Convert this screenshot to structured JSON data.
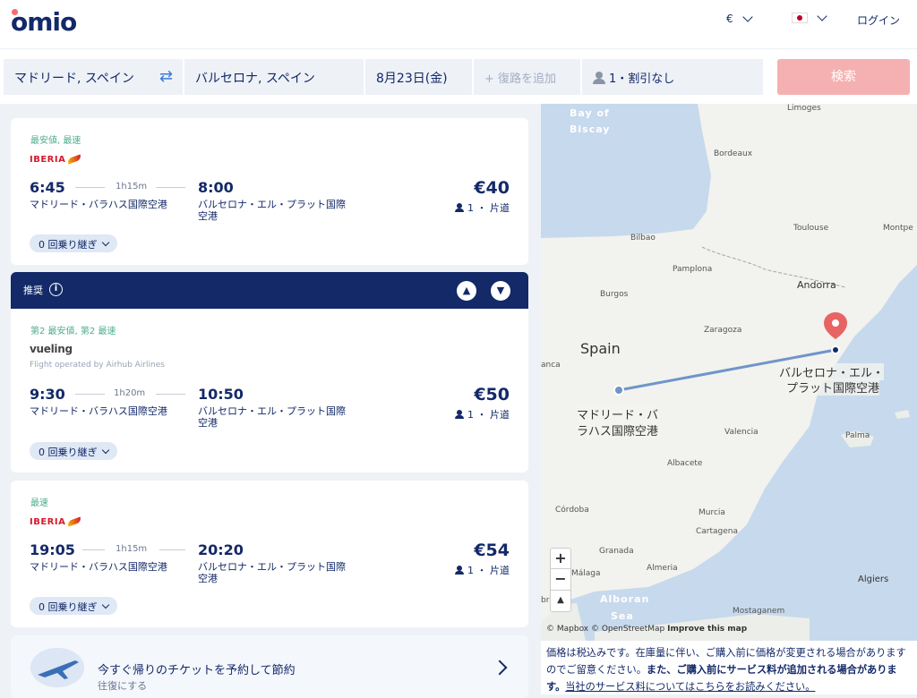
{
  "header": {
    "logo": "omio",
    "currency": "€",
    "login": "ログイン"
  },
  "search": {
    "origin": "マドリード, スペイン",
    "destination": "バルセロナ, スペイン",
    "date": "8月23日(金)",
    "return_placeholder": "+ 復路を追加",
    "passengers": "1・割引なし",
    "search_button": "検索"
  },
  "results": [
    {
      "tag": "最安値, 最速",
      "carrier": "IBERIA",
      "dep_time": "6:45",
      "duration": "1h15m",
      "arr_time": "8:00",
      "dep_place": "マドリード・バラハス国際空港",
      "arr_place_1": "バルセロナ・エル・プラット国際",
      "arr_place_2": "空港",
      "price": "€40",
      "pax": "1 ・ 片道",
      "stops": "0 回乗り継ぎ"
    },
    {
      "tag": "第2 最安値, 第2 最速",
      "carrier": "vueling",
      "operated_by": "Flight operated by Airhub Airlines",
      "dep_time": "9:30",
      "duration": "1h20m",
      "arr_time": "10:50",
      "dep_place": "マドリード・バラハス国際空港",
      "arr_place_1": "バルセロナ・エル・プラット国際",
      "arr_place_2": "空港",
      "price": "€50",
      "pax": "1 ・ 片道",
      "stops": "0 回乗り継ぎ"
    },
    {
      "tag": "最速",
      "carrier": "IBERIA",
      "dep_time": "19:05",
      "duration": "1h15m",
      "arr_time": "20:20",
      "dep_place": "マドリード・バラハス国際空港",
      "arr_place_1": "バルセロナ・エル・プラット国際",
      "arr_place_2": "空港",
      "price": "€54",
      "pax": "1 ・ 片道",
      "stops": "0 回乗り継ぎ"
    }
  ],
  "recommended": {
    "label": "推奨",
    "info": "i"
  },
  "promo": {
    "title": "今すぐ帰りのチケットを予約して節約",
    "subtitle": "往復にする"
  },
  "map": {
    "labels": {
      "bay": "Bay of",
      "biscay": "Biscay",
      "limoges": "Limoges",
      "bordeaux": "Bordeaux",
      "toulouse": "Toulouse",
      "montpe": "Montpe",
      "bilbao": "Bilbao",
      "pamplona": "Pamplona",
      "andorra": "Andorra",
      "burgos": "Burgos",
      "zaragoza": "Zaragoza",
      "spain": "Spain",
      "anca": "anca",
      "valencia": "Valencia",
      "palma": "Palma",
      "albacete": "Albacete",
      "cordoba": "Córdoba",
      "murcia": "Murcia",
      "cartagena": "Cartagena",
      "granada": "Granada",
      "malaga": "Málaga",
      "almeria": "Almeria",
      "algiers": "Algiers",
      "alboran": "Alboran",
      "sea": "Sea",
      "mostaganem": "Mostaganem",
      "br": "br"
    },
    "origin_label_1": "マドリード・バ",
    "origin_label_2": "ラハス国際空港",
    "dest_label_1": "バルセロナ・エル・",
    "dest_label_2": "プラット国際空港",
    "zoom_in": "+",
    "zoom_out": "−",
    "compass": "▲",
    "attribution": "© Mapbox © OpenStreetMap",
    "improve": "Improve this map"
  },
  "disclaimer": {
    "part1": "価格は税込みです。在庫量に伴い、ご購入前に価格が変更される場合がありますのでご留意ください。",
    "part2": "また、ご購入前にサービス料が追加される場合があります。",
    "part3": "当社のサービス料についてはこちらをお読みください。"
  },
  "colors": {
    "navy": "#132968",
    "accent_red": "#fa6b6b",
    "tag_green": "#4fae8c",
    "map_water": "#c7d9ec",
    "route": "#6f95c9"
  }
}
